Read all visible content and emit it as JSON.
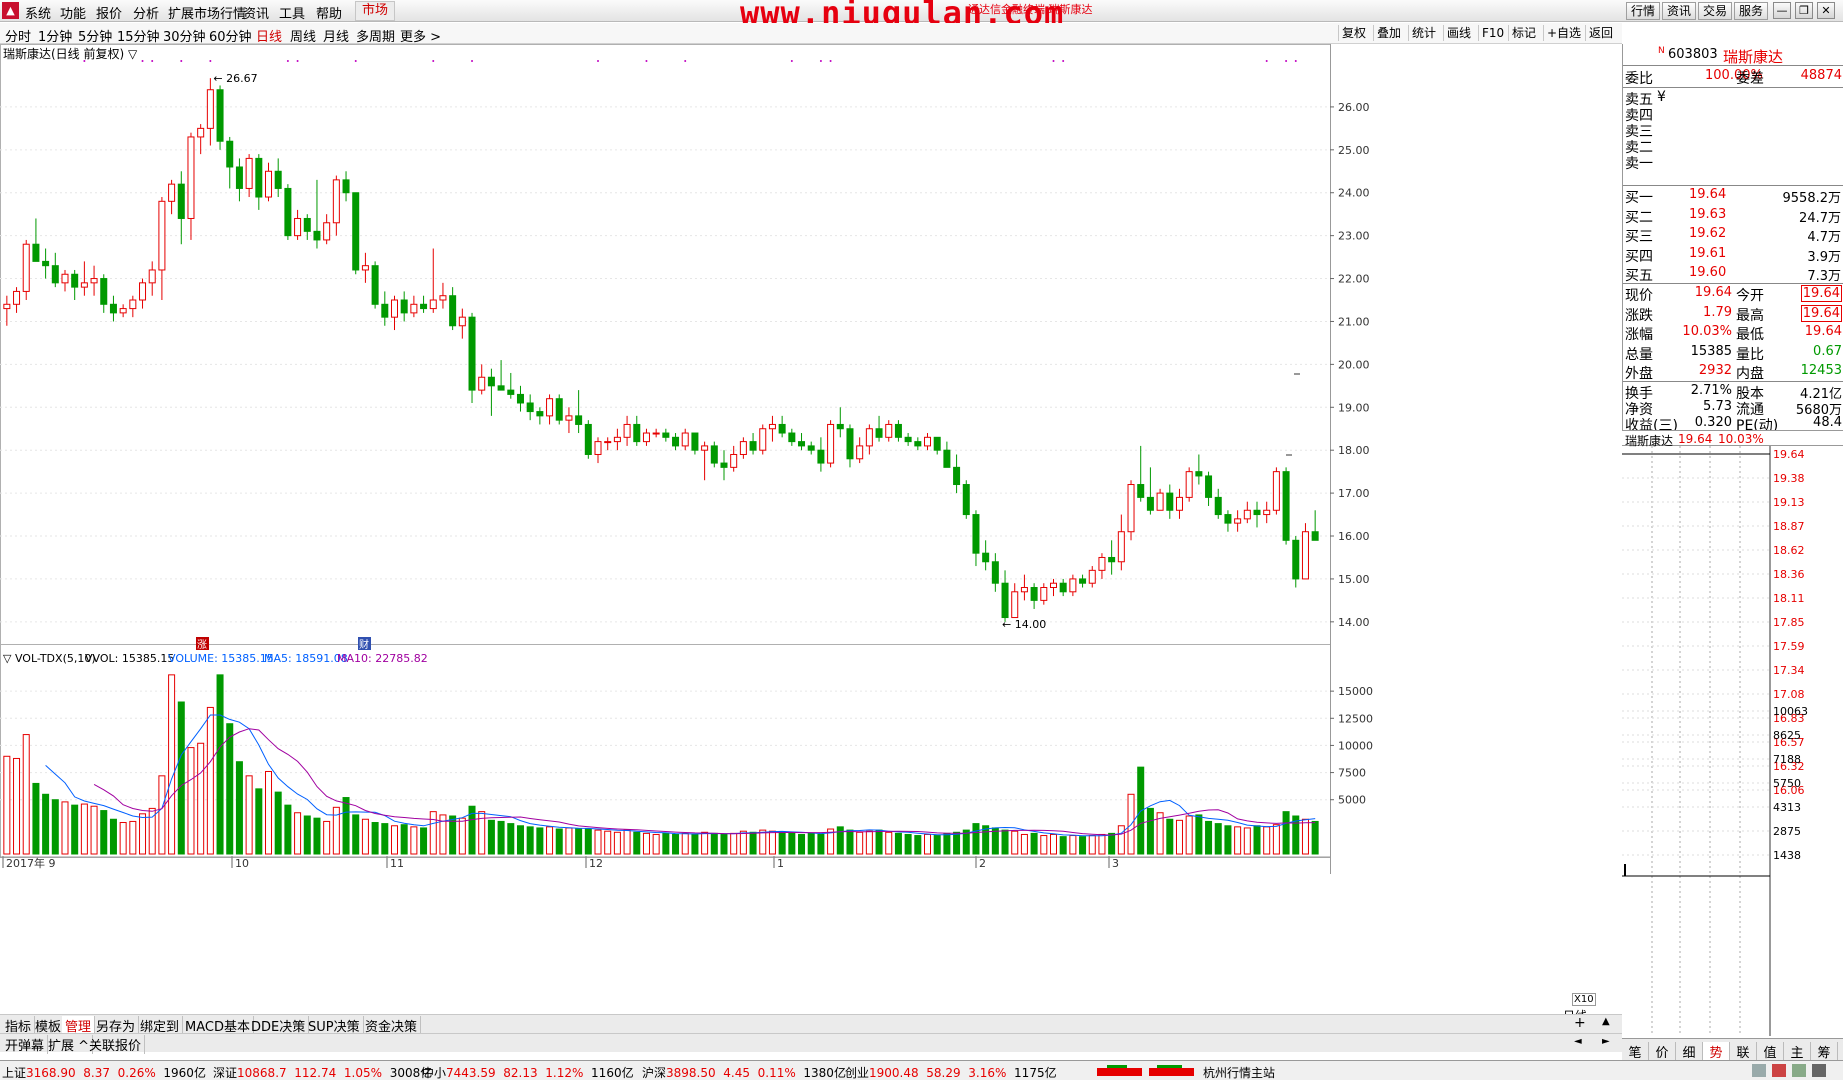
{
  "menubar": {
    "items": [
      "系统",
      "功能",
      "报价",
      "分析",
      "扩展市场行情",
      "资讯",
      "工具",
      "帮助"
    ],
    "market_label": "市场",
    "watermark": "www.niugulan.com",
    "watermark_small": "通达信金融终端  瑞斯康达",
    "right_buttons": [
      "行情",
      "资讯",
      "交易",
      "服务"
    ]
  },
  "periodbar": {
    "items": [
      "分时",
      "1分钟",
      "5分钟",
      "15分钟",
      "30分钟",
      "60分钟",
      "日线",
      "周线",
      "月线",
      "多周期",
      "更多 >"
    ],
    "active": "日线",
    "right_buttons": [
      "复权",
      "叠加",
      "统计",
      "画线",
      "F10",
      "标记",
      "+自选",
      "返回"
    ]
  },
  "chart": {
    "title": "瑞斯康达(日线 前复权) ▽",
    "high_label": "26.67",
    "low_label": "14.00",
    "vol_header": {
      "name": "▽ VOL-TDX(5,10)",
      "vvol": "VVOL: 15385.15",
      "volume": "VOLUME: 15385.15",
      "ma5": "MA5: 18591.08",
      "ma10": "MA10: 22785.82"
    },
    "price_ticks": [
      "26.00",
      "25.00",
      "24.00",
      "23.00",
      "22.00",
      "21.00",
      "20.00",
      "19.00",
      "18.00",
      "17.00",
      "16.00",
      "15.00",
      "14.00"
    ],
    "vol_ticks": [
      "15000",
      "12500",
      "10000",
      "7500",
      "5000"
    ],
    "x_labels": [
      "2017年 9",
      "10",
      "11",
      "12",
      "1",
      "2",
      "3"
    ],
    "markers": [
      "涨",
      "财"
    ],
    "x10": "X10",
    "daily_label": "日线",
    "colors": {
      "up": "#e60000",
      "down": "#009900",
      "ma5": "#0060ff",
      "ma10": "#a000a0"
    }
  },
  "chart_data": {
    "type": "candlestick",
    "title": "瑞斯康达(日线 前复权)",
    "ylim": [
      13.6,
      27.0
    ],
    "candles": [
      [
        21.3,
        21.6,
        20.9,
        21.4
      ],
      [
        21.4,
        21.8,
        21.2,
        21.7
      ],
      [
        21.7,
        22.9,
        21.5,
        22.8
      ],
      [
        22.8,
        23.4,
        22.6,
        22.4
      ],
      [
        22.4,
        22.7,
        22.0,
        22.3
      ],
      [
        22.3,
        22.6,
        21.8,
        21.9
      ],
      [
        21.9,
        22.2,
        21.7,
        22.1
      ],
      [
        22.1,
        22.2,
        21.5,
        21.8
      ],
      [
        21.8,
        22.4,
        21.6,
        21.9
      ],
      [
        21.9,
        22.3,
        21.6,
        22.0
      ],
      [
        22.0,
        22.1,
        21.2,
        21.4
      ],
      [
        21.4,
        21.6,
        21.0,
        21.2
      ],
      [
        21.2,
        21.4,
        21.1,
        21.3
      ],
      [
        21.3,
        21.6,
        21.1,
        21.5
      ],
      [
        21.5,
        22.0,
        21.3,
        21.9
      ],
      [
        21.9,
        22.4,
        21.6,
        22.2
      ],
      [
        22.2,
        23.9,
        21.5,
        23.8
      ],
      [
        23.8,
        24.3,
        23.5,
        24.2
      ],
      [
        24.2,
        24.5,
        22.8,
        23.4
      ],
      [
        23.4,
        25.4,
        22.9,
        25.3
      ],
      [
        25.3,
        25.6,
        24.9,
        25.5
      ],
      [
        25.5,
        26.67,
        25.1,
        26.4
      ],
      [
        26.4,
        26.5,
        25.0,
        25.2
      ],
      [
        25.2,
        25.3,
        24.1,
        24.6
      ],
      [
        24.6,
        24.8,
        23.8,
        24.1
      ],
      [
        24.1,
        24.9,
        23.9,
        24.8
      ],
      [
        24.8,
        24.9,
        23.6,
        23.9
      ],
      [
        23.9,
        24.7,
        23.8,
        24.5
      ],
      [
        24.5,
        24.8,
        23.9,
        24.1
      ],
      [
        24.1,
        24.2,
        22.9,
        23.0
      ],
      [
        23.0,
        23.6,
        22.9,
        23.4
      ],
      [
        23.4,
        23.5,
        22.9,
        23.1
      ],
      [
        23.1,
        24.3,
        22.7,
        22.9
      ],
      [
        22.9,
        23.5,
        22.8,
        23.3
      ],
      [
        23.3,
        24.4,
        23.0,
        24.3
      ],
      [
        24.3,
        24.5,
        23.8,
        24.0
      ],
      [
        24.0,
        24.0,
        22.1,
        22.2
      ],
      [
        22.2,
        22.6,
        21.9,
        22.3
      ],
      [
        22.3,
        22.4,
        21.3,
        21.4
      ],
      [
        21.4,
        21.7,
        20.9,
        21.1
      ],
      [
        21.1,
        21.6,
        20.8,
        21.5
      ],
      [
        21.5,
        21.7,
        21.0,
        21.2
      ],
      [
        21.2,
        21.6,
        21.1,
        21.4
      ],
      [
        21.4,
        21.6,
        21.2,
        21.3
      ],
      [
        21.3,
        22.7,
        21.2,
        21.5
      ],
      [
        21.5,
        21.9,
        21.3,
        21.6
      ],
      [
        21.6,
        21.8,
        20.8,
        20.9
      ],
      [
        20.9,
        21.3,
        20.6,
        21.1
      ],
      [
        21.1,
        21.2,
        19.1,
        19.4
      ],
      [
        19.4,
        20.0,
        19.3,
        19.7
      ],
      [
        19.7,
        19.9,
        18.8,
        19.5
      ],
      [
        19.5,
        20.1,
        19.4,
        19.4
      ],
      [
        19.4,
        19.8,
        19.2,
        19.3
      ],
      [
        19.3,
        19.5,
        18.9,
        19.1
      ],
      [
        19.1,
        19.3,
        18.7,
        18.9
      ],
      [
        18.9,
        19.0,
        18.6,
        18.8
      ],
      [
        18.8,
        19.3,
        18.6,
        19.2
      ],
      [
        19.2,
        19.3,
        18.6,
        18.7
      ],
      [
        18.7,
        19.0,
        18.4,
        18.8
      ],
      [
        18.8,
        19.4,
        18.4,
        18.6
      ],
      [
        18.6,
        18.7,
        17.8,
        17.9
      ],
      [
        17.9,
        18.3,
        17.7,
        18.2
      ],
      [
        18.2,
        18.3,
        18.0,
        18.2
      ],
      [
        18.2,
        18.5,
        18.0,
        18.3
      ],
      [
        18.3,
        18.8,
        18.1,
        18.6
      ],
      [
        18.6,
        18.8,
        18.1,
        18.2
      ],
      [
        18.2,
        18.5,
        18.1,
        18.4
      ],
      [
        18.4,
        18.5,
        18.3,
        18.4
      ],
      [
        18.4,
        18.5,
        18.2,
        18.3
      ],
      [
        18.3,
        18.4,
        18.0,
        18.1
      ],
      [
        18.1,
        18.5,
        18.0,
        18.4
      ],
      [
        18.4,
        18.4,
        17.9,
        18.0
      ],
      [
        18.0,
        18.2,
        17.3,
        18.1
      ],
      [
        18.1,
        18.2,
        17.6,
        17.7
      ],
      [
        17.7,
        18.0,
        17.3,
        17.6
      ],
      [
        17.6,
        18.1,
        17.5,
        17.9
      ],
      [
        17.9,
        18.3,
        17.8,
        18.2
      ],
      [
        18.2,
        18.4,
        17.9,
        18.0
      ],
      [
        18.0,
        18.6,
        17.9,
        18.5
      ],
      [
        18.5,
        18.8,
        18.2,
        18.6
      ],
      [
        18.6,
        18.8,
        18.3,
        18.4
      ],
      [
        18.4,
        18.5,
        18.1,
        18.2
      ],
      [
        18.2,
        18.4,
        18.0,
        18.1
      ],
      [
        18.1,
        18.2,
        17.9,
        18.0
      ],
      [
        18.0,
        18.3,
        17.5,
        17.7
      ],
      [
        17.7,
        18.7,
        17.6,
        18.6
      ],
      [
        18.6,
        19.0,
        18.3,
        18.5
      ],
      [
        18.5,
        18.6,
        17.6,
        17.8
      ],
      [
        17.8,
        18.3,
        17.7,
        18.1
      ],
      [
        18.1,
        18.6,
        17.9,
        18.5
      ],
      [
        18.5,
        18.8,
        18.2,
        18.3
      ],
      [
        18.3,
        18.7,
        18.2,
        18.6
      ],
      [
        18.6,
        18.7,
        18.2,
        18.3
      ],
      [
        18.3,
        18.4,
        18.1,
        18.2
      ],
      [
        18.2,
        18.3,
        18.0,
        18.1
      ],
      [
        18.1,
        18.4,
        18.0,
        18.3
      ],
      [
        18.3,
        18.3,
        17.9,
        18.0
      ],
      [
        18.0,
        18.2,
        17.6,
        17.6
      ],
      [
        17.6,
        17.9,
        17.0,
        17.2
      ],
      [
        17.2,
        17.3,
        16.4,
        16.5
      ],
      [
        16.5,
        16.6,
        15.3,
        15.6
      ],
      [
        15.6,
        15.9,
        15.2,
        15.4
      ],
      [
        15.4,
        15.6,
        14.7,
        14.9
      ],
      [
        14.9,
        15.2,
        14.0,
        14.1
      ],
      [
        14.1,
        14.9,
        14.1,
        14.7
      ],
      [
        14.7,
        15.1,
        14.5,
        14.8
      ],
      [
        14.8,
        14.9,
        14.3,
        14.5
      ],
      [
        14.5,
        14.9,
        14.4,
        14.8
      ],
      [
        14.8,
        15.0,
        14.6,
        14.9
      ],
      [
        14.9,
        15.0,
        14.6,
        14.7
      ],
      [
        14.7,
        15.1,
        14.6,
        15.0
      ],
      [
        15.0,
        15.1,
        14.8,
        14.9
      ],
      [
        14.9,
        15.3,
        14.8,
        15.2
      ],
      [
        15.2,
        15.6,
        15.0,
        15.5
      ],
      [
        15.5,
        15.9,
        15.1,
        15.4
      ],
      [
        15.4,
        16.5,
        15.2,
        16.1
      ],
      [
        16.1,
        17.3,
        15.9,
        17.2
      ],
      [
        17.2,
        18.1,
        16.8,
        16.9
      ],
      [
        16.9,
        17.6,
        16.5,
        16.6
      ],
      [
        16.6,
        17.1,
        16.6,
        17.0
      ],
      [
        17.0,
        17.2,
        16.4,
        16.6
      ],
      [
        16.6,
        17.1,
        16.4,
        16.9
      ],
      [
        16.9,
        17.6,
        16.8,
        17.5
      ],
      [
        17.5,
        17.9,
        17.2,
        17.4
      ],
      [
        17.4,
        17.5,
        16.7,
        16.9
      ],
      [
        16.9,
        17.1,
        16.4,
        16.5
      ],
      [
        16.5,
        16.6,
        16.1,
        16.3
      ],
      [
        16.3,
        16.6,
        16.1,
        16.4
      ],
      [
        16.4,
        16.8,
        16.3,
        16.6
      ],
      [
        16.6,
        16.8,
        16.2,
        16.5
      ],
      [
        16.5,
        16.8,
        16.3,
        16.6
      ],
      [
        16.6,
        17.6,
        16.5,
        17.5
      ],
      [
        17.5,
        17.6,
        15.8,
        15.9
      ],
      [
        15.9,
        16.0,
        14.8,
        15.0
      ],
      [
        15.0,
        16.3,
        15.0,
        16.1
      ],
      [
        16.1,
        16.6,
        15.9,
        15.9
      ]
    ],
    "volume": [
      9000,
      8800,
      11000,
      6500,
      5500,
      5000,
      4800,
      4500,
      4600,
      4400,
      4000,
      3200,
      2900,
      3000,
      3700,
      4200,
      7200,
      16500,
      14000,
      9800,
      10200,
      13500,
      16500,
      12000,
      8500,
      7200,
      6000,
      7600,
      5700,
      4500,
      3800,
      3500,
      3300,
      3000,
      4300,
      5200,
      3600,
      3200,
      2900,
      2800,
      2600,
      2700,
      2500,
      2400,
      3900,
      3600,
      3500,
      3300,
      4400,
      3900,
      3100,
      3000,
      2800,
      2600,
      2500,
      2400,
      2500,
      2300,
      2400,
      2300,
      2300,
      2200,
      2100,
      2000,
      2200,
      2000,
      1900,
      1800,
      1900,
      1800,
      1900,
      1800,
      2000,
      1900,
      1800,
      1900,
      2100,
      2000,
      2200,
      2100,
      2000,
      1900,
      1800,
      1900,
      1800,
      2300,
      2500,
      2200,
      2000,
      2100,
      2200,
      2000,
      1900,
      1800,
      1700,
      1800,
      1700,
      1900,
      2000,
      2200,
      2800,
      2600,
      2400,
      2200,
      2100,
      1800,
      1900,
      1700,
      1800,
      1600,
      1700,
      1600,
      1700,
      1800,
      1900,
      2600,
      5500,
      8000,
      4200,
      3800,
      3200,
      3100,
      3500,
      3600,
      3000,
      2800,
      2600,
      2500,
      2400,
      2600,
      2500,
      2700,
      3900,
      3500,
      3200,
      3000
    ],
    "vol_ylim": [
      0,
      17500
    ]
  },
  "quote": {
    "code_label": "N",
    "code": "603803",
    "name": "瑞斯康达",
    "weibi_label": "委比",
    "weibi": "100.00%",
    "weicha_label": "委差",
    "weicha": "48874",
    "sell": [
      {
        "label": "卖五",
        "price": "",
        "vol": "",
        "mark": "¥"
      },
      {
        "label": "卖四",
        "price": "",
        "vol": ""
      },
      {
        "label": "卖三",
        "price": "",
        "vol": ""
      },
      {
        "label": "卖二",
        "price": "",
        "vol": ""
      },
      {
        "label": "卖一",
        "price": "",
        "vol": ""
      }
    ],
    "buy": [
      {
        "label": "买一",
        "price": "19.64",
        "vol": "9558.2万"
      },
      {
        "label": "买二",
        "price": "19.63",
        "vol": "24.7万"
      },
      {
        "label": "买三",
        "price": "19.62",
        "vol": "4.7万"
      },
      {
        "label": "买四",
        "price": "19.61",
        "vol": "3.9万"
      },
      {
        "label": "买五",
        "price": "19.60",
        "vol": "7.3万"
      }
    ],
    "stats": [
      {
        "l1": "现价",
        "v1": "19.64",
        "c1": "red",
        "l2": "今开",
        "v2": "19.64",
        "c2": "red",
        "box2": true
      },
      {
        "l1": "涨跌",
        "v1": "1.79",
        "c1": "red",
        "l2": "最高",
        "v2": "19.64",
        "c2": "red",
        "box2": true
      },
      {
        "l1": "涨幅",
        "v1": "10.03%",
        "c1": "red",
        "l2": "最低",
        "v2": "19.64",
        "c2": "red"
      },
      {
        "l1": "总量",
        "v1": "15385",
        "c1": "black",
        "l2": "量比",
        "v2": "0.67",
        "c2": "green"
      },
      {
        "l1": "外盘",
        "v1": "2932",
        "c1": "red",
        "l2": "内盘",
        "v2": "12453",
        "c2": "green"
      }
    ],
    "stats2": [
      {
        "l1": "换手",
        "v1": "2.71%",
        "l2": "股本",
        "v2": "4.21亿"
      },
      {
        "l1": "净资",
        "v1": "5.73",
        "l2": "流通",
        "v2": "5680万"
      },
      {
        "l1": "收益(三)",
        "v1": "0.320",
        "l2": "PE(动)",
        "v2": "48.4"
      }
    ]
  },
  "mini": {
    "title_name": "瑞斯康达",
    "title_price": "19.64",
    "title_pct": "10.03%",
    "price_ticks": [
      "19.64",
      "19.38",
      "19.13",
      "18.87",
      "18.62",
      "18.36",
      "18.11",
      "17.85",
      "17.59",
      "17.34",
      "17.08",
      "16.83",
      "16.57",
      "16.32",
      "16.06"
    ],
    "vol_ticks": [
      "10063",
      "8625",
      "7188",
      "5750",
      "4313",
      "2875",
      "1438"
    ]
  },
  "bottom_tabs": [
    "指标",
    "模板",
    "管理",
    "另存为",
    "绑定到",
    "MACD基本",
    "DDE决策",
    "SUP决策",
    "资金决策"
  ],
  "bottom_tabs_active": "管理",
  "bottom_tabs2": [
    "开弹幕",
    "扩展 ^",
    "关联报价"
  ],
  "right_tabs": [
    "笔",
    "价",
    "细",
    "势",
    "联",
    "值",
    "主",
    "筹"
  ],
  "right_tabs_active": "势",
  "status": [
    {
      "name": "上证",
      "val": "3168.90",
      "chg": "8.37",
      "pct": "0.26%",
      "amt": "1960亿"
    },
    {
      "name": "深证",
      "val": "10868.7",
      "chg": "112.74",
      "pct": "1.05%",
      "amt": "3008亿"
    },
    {
      "name": "中小",
      "val": "7443.59",
      "chg": "82.13",
      "pct": "1.12%",
      "amt": "1160亿"
    },
    {
      "name": "沪深",
      "val": "3898.50",
      "chg": "4.45",
      "pct": "0.11%",
      "amt": "1380亿"
    },
    {
      "name": "创业",
      "val": "1900.48",
      "chg": "58.29",
      "pct": "3.16%",
      "amt": "1175亿"
    }
  ],
  "status_right": "杭州行情主站"
}
